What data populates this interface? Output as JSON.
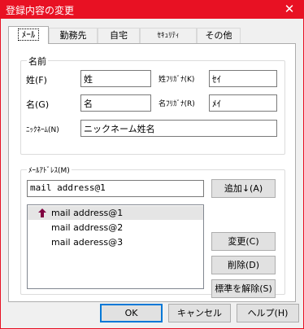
{
  "window": {
    "title": "登録内容の変更",
    "close_glyph": "✕"
  },
  "tabs": [
    {
      "label": "ﾒｰﾙ",
      "active": true
    },
    {
      "label": "勤務先"
    },
    {
      "label": "自宅"
    },
    {
      "label": "ｾｷｭﾘﾃｨ"
    },
    {
      "label": "その他"
    }
  ],
  "name_group": {
    "title": "名前",
    "last_name_label": "姓(F)",
    "last_name_value": "姓",
    "last_kana_label": "姓ﾌﾘｶﾞﾅ(K)",
    "last_kana_value": "ｾｲ",
    "first_name_label": "名(G)",
    "first_name_value": "名",
    "first_kana_label": "名ﾌﾘｶﾞﾅ(R)",
    "first_kana_value": "ﾒｲ",
    "nickname_label": "ﾆｯｸﾈｰﾑ(N)",
    "nickname_value": "ニックネーム姓名"
  },
  "mail_group": {
    "title": "ﾒｰﾙｱﾄﾞﾚｽ(M)",
    "input_value": "mail address@1",
    "add_button": "追加↓(A)",
    "items": [
      "mail address@1",
      "mail address@2",
      "mail aderess@3"
    ],
    "change_button": "変更(C)",
    "delete_button": "削除(D)",
    "unset_default_button": "標準を解除(S)"
  },
  "footer": {
    "ok": "OK",
    "cancel": "キャンセル",
    "help": "ヘルプ(H)"
  }
}
